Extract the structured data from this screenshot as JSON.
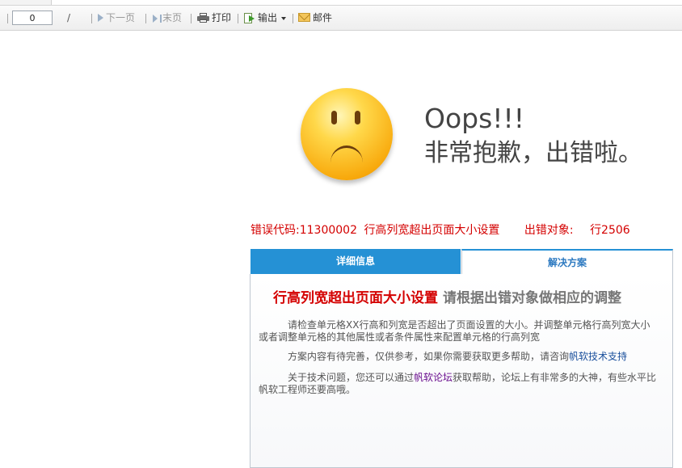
{
  "toolbar": {
    "page_value": "0",
    "slash": "/",
    "next_label": "下一页",
    "last_label": "末页",
    "print_label": "打印",
    "export_label": "输出",
    "mail_label": "邮件",
    "icons": [
      "next-page-icon",
      "last-page-icon",
      "printer-icon",
      "export-icon",
      "dropdown-caret-icon",
      "mail-icon"
    ]
  },
  "error": {
    "oops": "Oops!!!",
    "sorry": "非常抱歉，出错啦。",
    "code_label": "错误代码:",
    "code_value": "11300002",
    "code_message": "行高列宽超出页面大小设置",
    "target_label": "出错对象:",
    "target_value": "行2506"
  },
  "tabs": {
    "detail": "详细信息",
    "solution": "解决方案"
  },
  "solution": {
    "title_main": "行高列宽超出页面大小设置",
    "title_sub": "请根据出错对象做相应的调整",
    "para1": "请检查单元格XX行高和列宽是否超出了页面设置的大小。并调整单元格行高列宽大小或者调整单元格的其他属性或者条件属性来配置单元格的行高列宽",
    "para2_prefix": "方案内容有待完善，仅供参考，如果你需要获取更多帮助，请咨询",
    "para2_link": "帆软技术支持",
    "para3_prefix": "关于技术问题，您还可以通过",
    "para3_link": "帆软论坛",
    "para3_suffix": "获取帮助，论坛上有非常多的大神，有些水平比帆软工程师还要高哦。"
  },
  "colors": {
    "error_red": "#d40000",
    "tab_blue": "#2591d5",
    "link_blue": "#1a4f9c",
    "link_purple": "#6a0f8e"
  }
}
